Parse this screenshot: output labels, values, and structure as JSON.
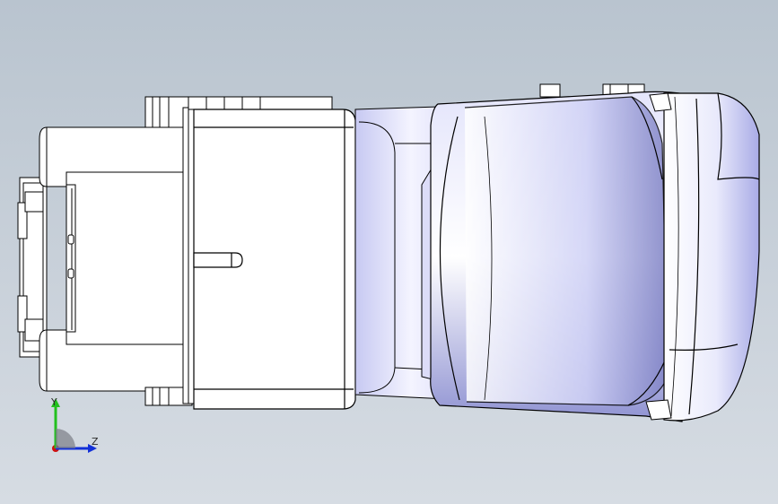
{
  "viewport": {
    "background_top": "#b9c4cf",
    "background_bottom": "#d6dce3"
  },
  "model": {
    "body_color": "#ffffff",
    "shade_color": "#c9cbf1",
    "deep_shade_color": "#7d80c4",
    "edge_color": "#000000"
  },
  "triad": {
    "y_label": "Y",
    "z_label": "Z",
    "y_color": "#22c01e",
    "z_color": "#1230d8",
    "x_color": "#d01010"
  }
}
